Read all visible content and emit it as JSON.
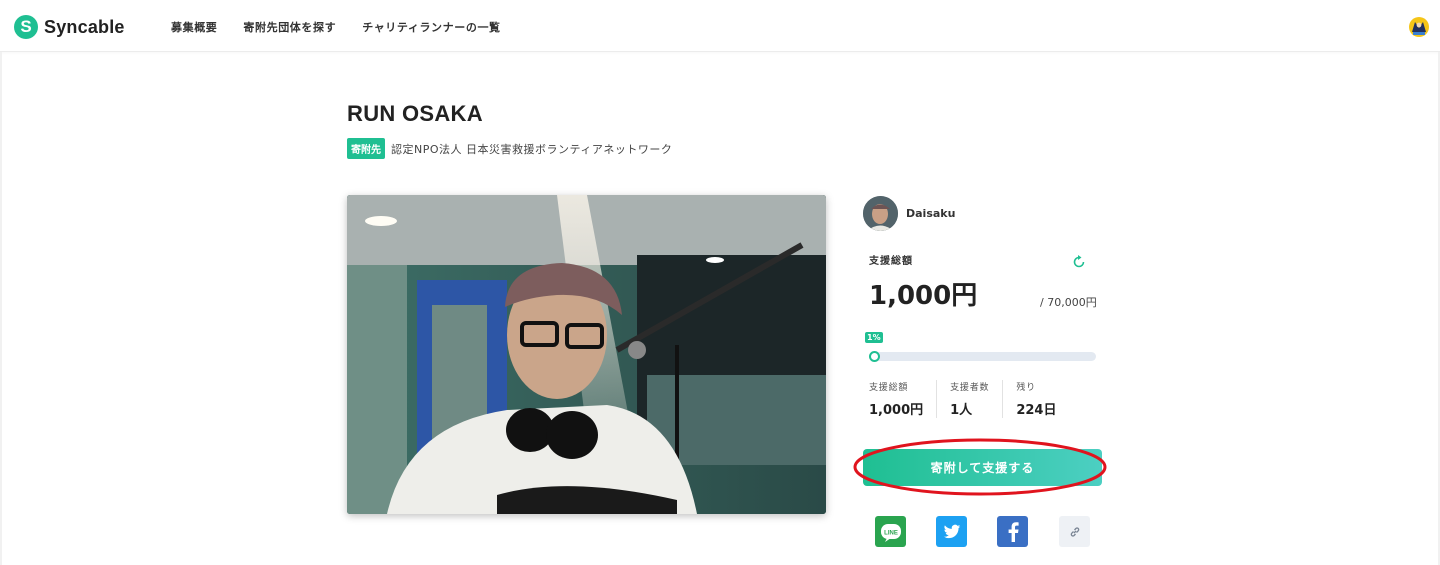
{
  "header": {
    "logo_text": "Syncable",
    "logo_mark": "S",
    "nav": [
      "募集概要",
      "寄附先団体を探す",
      "チャリティランナーの一覧"
    ],
    "avatar_icon": "user-avatar-icon"
  },
  "campaign": {
    "title": "RUN OSAKA",
    "beneficiary_badge": "寄附先",
    "beneficiary_name": "認定NPO法人 日本災害救援ボランティアネットワーク"
  },
  "runner": {
    "name": "Daisaku"
  },
  "funding": {
    "total_label": "支援総額",
    "total_amount": "1,000円",
    "goal": "/ 70,000円",
    "progress_label": "1%",
    "progress_fraction": 0.01,
    "stats": [
      {
        "label": "支援総額",
        "value": "1,000円"
      },
      {
        "label": "支援者数",
        "value": "1人"
      },
      {
        "label": "残り",
        "value": "224日"
      }
    ],
    "donate_label": "寄附して支援する"
  },
  "share": {
    "line_label": "LINE",
    "icons": [
      "line-icon",
      "twitter-icon",
      "facebook-icon",
      "link-icon"
    ]
  },
  "colors": {
    "brand": "#1fbf92",
    "annotation": "#e0141e",
    "twitter": "#1da1f2",
    "facebook": "#3a6fc4",
    "line": "#2aa44f"
  }
}
